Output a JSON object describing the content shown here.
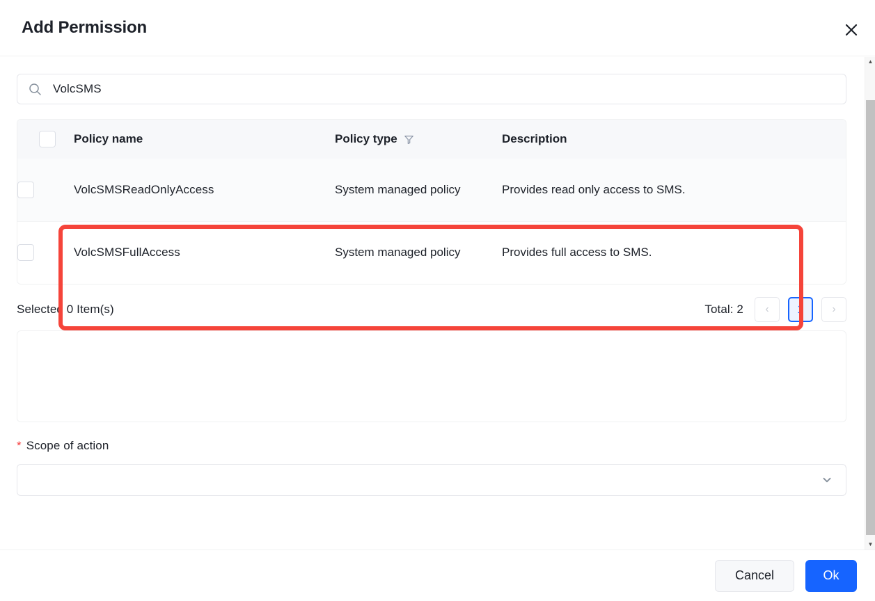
{
  "dialog": {
    "title": "Add Permission",
    "close_label": "×",
    "close_icon": "close-icon"
  },
  "search": {
    "icon": "search-icon",
    "value": "VolcSMS",
    "placeholder": "Search"
  },
  "table": {
    "columns": [
      {
        "key": "checkbox",
        "label": ""
      },
      {
        "key": "name",
        "label": "Policy name"
      },
      {
        "key": "type",
        "label": "Policy type",
        "filter_icon": "filter-icon"
      },
      {
        "key": "description",
        "label": "Description"
      }
    ],
    "rows": [
      {
        "name": "VolcSMSReadOnlyAccess",
        "type": "System managed policy",
        "description": "Provides read only access to SMS.",
        "checked": false
      },
      {
        "name": "VolcSMSFullAccess",
        "type": "System managed policy",
        "description": "Provides full access to SMS.",
        "checked": false
      }
    ]
  },
  "meta": {
    "selected_text": "Selected 0 Item(s)",
    "total_text": "Total: 2",
    "prev_label": "‹",
    "page_label": "1",
    "next_label": "›"
  },
  "scope": {
    "required_mark": "*",
    "label": "Scope of action",
    "value": "",
    "placeholder": "",
    "chevron_icon": "chevron-down-icon"
  },
  "footer": {
    "cancel_label": "Cancel",
    "ok_label": "Ok"
  },
  "scrollbar": {
    "up_label": "▲",
    "down_label": "▼"
  },
  "colors": {
    "accent": "#1664FF",
    "highlight": "#F5443A",
    "required": "#F53F3F",
    "header_bg": "#F7F8FA"
  }
}
